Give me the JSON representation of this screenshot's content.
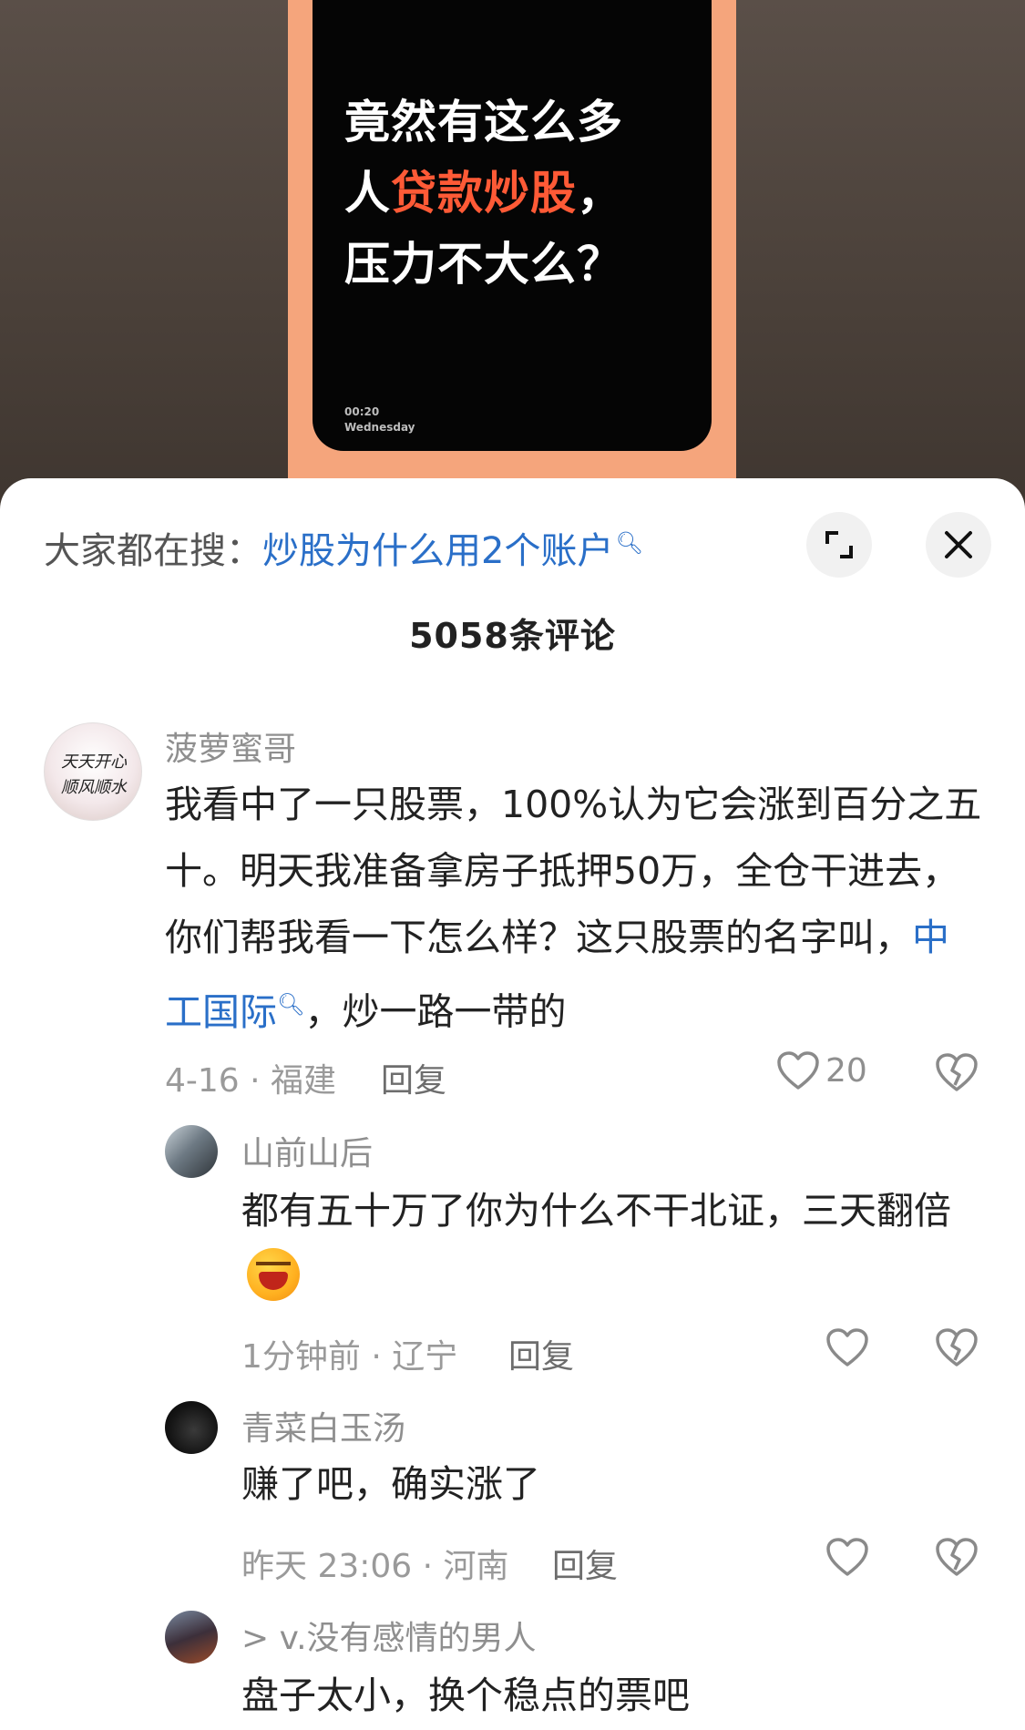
{
  "video": {
    "headline_line1": "竟然有这么多",
    "headline_line2_pre": "人",
    "headline_line2_highlight": "贷款炒股",
    "headline_line2_post": "，",
    "headline_line3": "压力不大么？",
    "time": "00:20",
    "day": "Wednesday",
    "highlight_color": "#ff5a36",
    "frame_color": "#f5a57c"
  },
  "sheet": {
    "search_prefix": "大家都在搜：",
    "search_term": "炒股为什么用2个账户",
    "search_icon": "search-icon",
    "expand_icon": "expand-icon",
    "close_icon": "close-icon",
    "comment_count": "5058条评论"
  },
  "comments": [
    {
      "username": "菠萝蜜哥",
      "avatar_text_1": "天天开心",
      "avatar_text_2": "顺风顺水",
      "content_pre": "我看中了一只股票，100%认为它会涨到百分之五十。明天我准备拿房子抵押50万，全仓干进去，你们帮我看一下怎么样？这只股票的名字叫，",
      "content_link": "中工国际",
      "content_post": "，炒一路一带的",
      "meta": "4-16 · 福建",
      "reply": "回复",
      "likes": "20"
    },
    {
      "username": "山前山后",
      "content": "都有五十万了你为什么不干北证，三天翻倍",
      "emoji": "laughing-emoji",
      "meta": "1分钟前 · 辽宁",
      "reply": "回复"
    },
    {
      "username": "青菜白玉汤",
      "content": "赚了吧，确实涨了",
      "meta": "昨天 23:06 · 河南",
      "reply": "回复"
    },
    {
      "username": "> v.没有感情的男人",
      "content": "盘子太小，换个稳点的票吧"
    }
  ],
  "colors": {
    "link": "#2a6fc8",
    "username": "#8f8f8f",
    "text": "#222222"
  }
}
